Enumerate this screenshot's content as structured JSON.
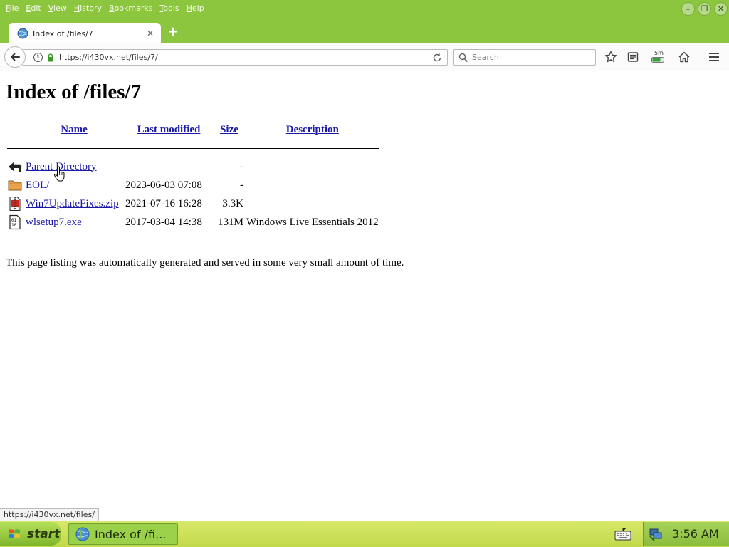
{
  "browser": {
    "menu": [
      {
        "acc": "F",
        "rest": "ile"
      },
      {
        "acc": "E",
        "rest": "dit"
      },
      {
        "acc": "V",
        "rest": "iew"
      },
      {
        "acc": "H",
        "rest": "istory"
      },
      {
        "acc": "B",
        "rest": "ookmarks"
      },
      {
        "acc": "T",
        "rest": "ools"
      },
      {
        "acc": "H",
        "rest": "elp"
      }
    ],
    "tab_title": "Index of /files/7",
    "new_tab": "+",
    "url": "https://i430vx.net/files/7/",
    "search_placeholder": "Search",
    "sync_label": "5m",
    "win_controls": {
      "minimize": "–",
      "restore": "❐",
      "close": "✕"
    },
    "colors": {
      "chrome": "#8cc63f",
      "link": "#1a1aa6",
      "taskbar": "#c2d94a"
    }
  },
  "page": {
    "title": "Index of /files/7",
    "headers": {
      "name": "Name",
      "last_modified": "Last modified",
      "size": "Size",
      "description": "Description"
    },
    "rows": [
      {
        "icon": "back-arrow-icon",
        "name": "Parent Directory",
        "modified": "",
        "size": "-",
        "description": ""
      },
      {
        "icon": "folder-icon",
        "name": "EOL/",
        "modified": "2023-06-03 07:08",
        "size": "-",
        "description": ""
      },
      {
        "icon": "compressed-file-icon",
        "name": "Win7UpdateFixes.zip",
        "modified": "2021-07-16 16:28",
        "size": "3.3K",
        "description": ""
      },
      {
        "icon": "binary-file-icon",
        "name": "wlsetup7.exe",
        "modified": "2017-03-04 14:38",
        "size": "131M",
        "description": "Windows Live Essentials 2012"
      }
    ],
    "footer": "This page listing was automatically generated and served in some very small amount of time."
  },
  "status_url": "https://i430vx.net/files/",
  "taskbar": {
    "start": "start",
    "task_label": "Index of /fi...",
    "clock": "3:56 AM"
  }
}
